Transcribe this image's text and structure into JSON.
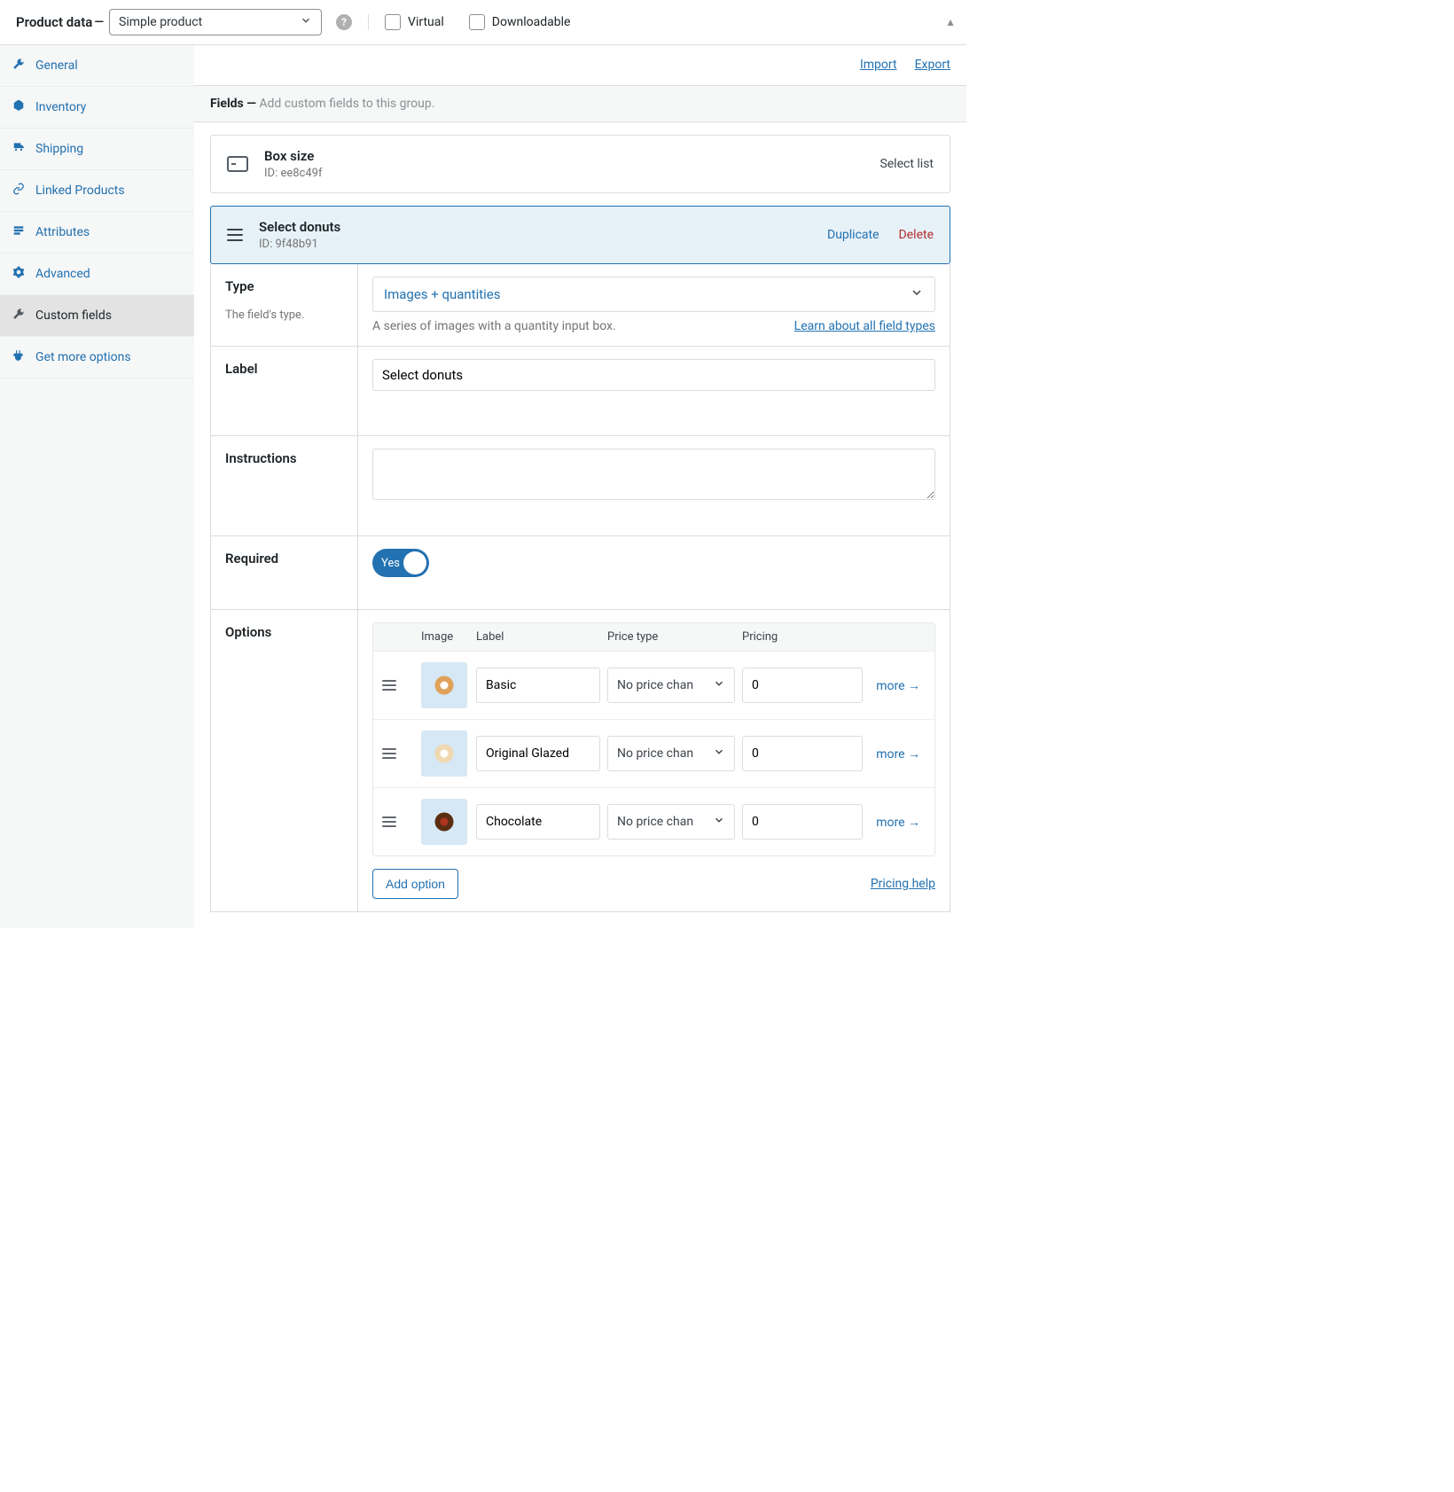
{
  "header": {
    "title": "Product data",
    "dash": "—",
    "product_type": "Simple product",
    "virtual_label": "Virtual",
    "downloadable_label": "Downloadable"
  },
  "sidebar": {
    "items": [
      {
        "label": "General"
      },
      {
        "label": "Inventory"
      },
      {
        "label": "Shipping"
      },
      {
        "label": "Linked Products"
      },
      {
        "label": "Attributes"
      },
      {
        "label": "Advanced"
      },
      {
        "label": "Custom fields"
      },
      {
        "label": "Get more options"
      }
    ]
  },
  "toolbar": {
    "import_label": "Import",
    "export_label": "Export"
  },
  "fields_header": {
    "strong": "Fields —",
    "hint": "Add custom fields to this group."
  },
  "cards": {
    "box": {
      "title": "Box size",
      "id": "ID: ee8c49f",
      "right_label": "Select list"
    },
    "donuts": {
      "title": "Select donuts",
      "id": "ID: 9f48b91",
      "duplicate_label": "Duplicate",
      "delete_label": "Delete"
    }
  },
  "settings": {
    "type": {
      "label": "Type",
      "desc": "The field's type.",
      "value": "Images + quantities",
      "hint": "A series of images with a quantity input box.",
      "link": "Learn about all field types"
    },
    "label": {
      "label": "Label",
      "value": "Select donuts"
    },
    "instructions": {
      "label": "Instructions",
      "value": ""
    },
    "required": {
      "label": "Required",
      "toggle_text": "Yes"
    },
    "options": {
      "label": "Options",
      "col_image": "Image",
      "col_label": "Label",
      "col_price_type": "Price type",
      "col_pricing": "Pricing",
      "rows": [
        {
          "label": "Basic",
          "price_type": "No price chan",
          "pricing": "0",
          "more": "more →",
          "color_outer": "#e0a15a",
          "color_inner": "#ffffff"
        },
        {
          "label": "Original Glazed",
          "price_type": "No price chan",
          "pricing": "0",
          "more": "more →",
          "color_outer": "#f0d8b0",
          "color_inner": "#ffffff"
        },
        {
          "label": "Chocolate",
          "price_type": "No price chan",
          "pricing": "0",
          "more": "more →",
          "color_outer": "#5b2e12",
          "color_inner": "#b0351e"
        }
      ],
      "add_option_label": "Add option",
      "pricing_help_label": "Pricing help"
    }
  }
}
